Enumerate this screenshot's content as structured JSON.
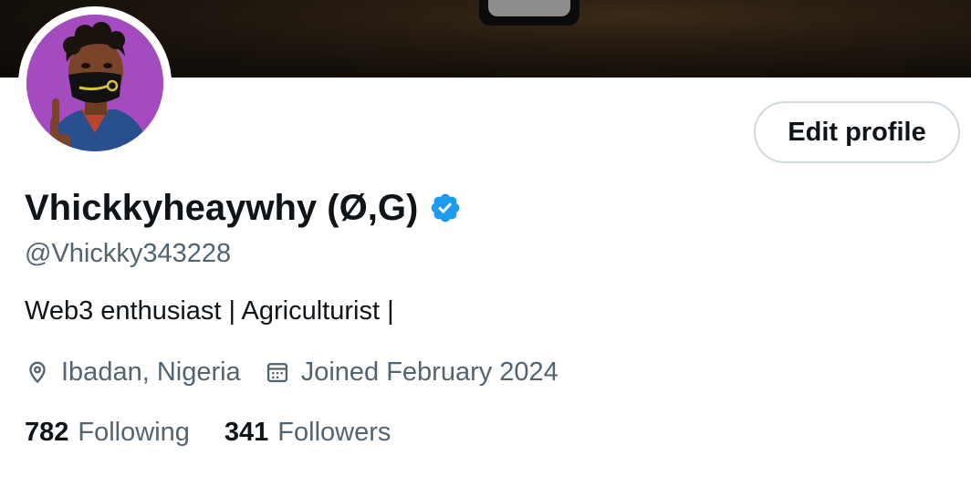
{
  "profile": {
    "display_name": "Vhickkyheaywhy (Ø,G)",
    "handle": "@Vhickky343228",
    "bio": "Web3 enthusiast | Agriculturist |",
    "verified": true,
    "location": "Ibadan, Nigeria",
    "joined": "Joined February 2024",
    "following_count": "782",
    "following_label": "Following",
    "followers_count": "341",
    "followers_label": "Followers"
  },
  "actions": {
    "edit_profile_label": "Edit profile"
  },
  "icons": {
    "verified": "verified-badge-icon",
    "location": "location-pin-icon",
    "joined": "calendar-icon"
  },
  "colors": {
    "verified_blue": "#1d9bf0",
    "text_primary": "#0f1419",
    "text_secondary": "#536471",
    "border": "#cfd9de",
    "avatar_bg": "#a54bc0"
  }
}
